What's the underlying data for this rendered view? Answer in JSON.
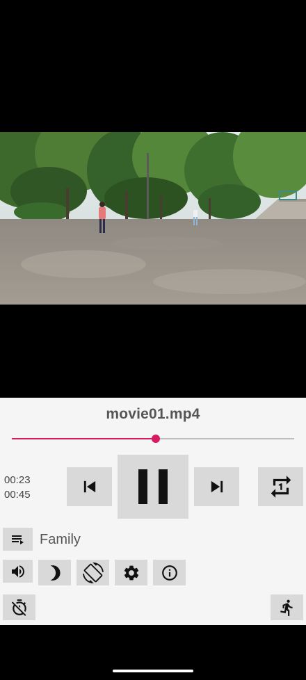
{
  "player": {
    "filename": "movie01.mp4",
    "current_time": "00:23",
    "total_time": "00:45",
    "progress": 0.51,
    "accent_color": "#d81b60",
    "playlist_name": "Family"
  },
  "icons": {
    "previous": "skip-previous-icon",
    "pause": "pause-icon",
    "next": "skip-next-icon",
    "repeat": "repeat-one-icon",
    "playlist": "playlist-icon",
    "volume": "volume-icon",
    "night": "crescent-moon-icon",
    "rotate": "screen-rotation-icon",
    "settings": "gear-icon",
    "info": "info-icon",
    "timer": "timer-off-icon",
    "exit": "running-person-icon"
  }
}
